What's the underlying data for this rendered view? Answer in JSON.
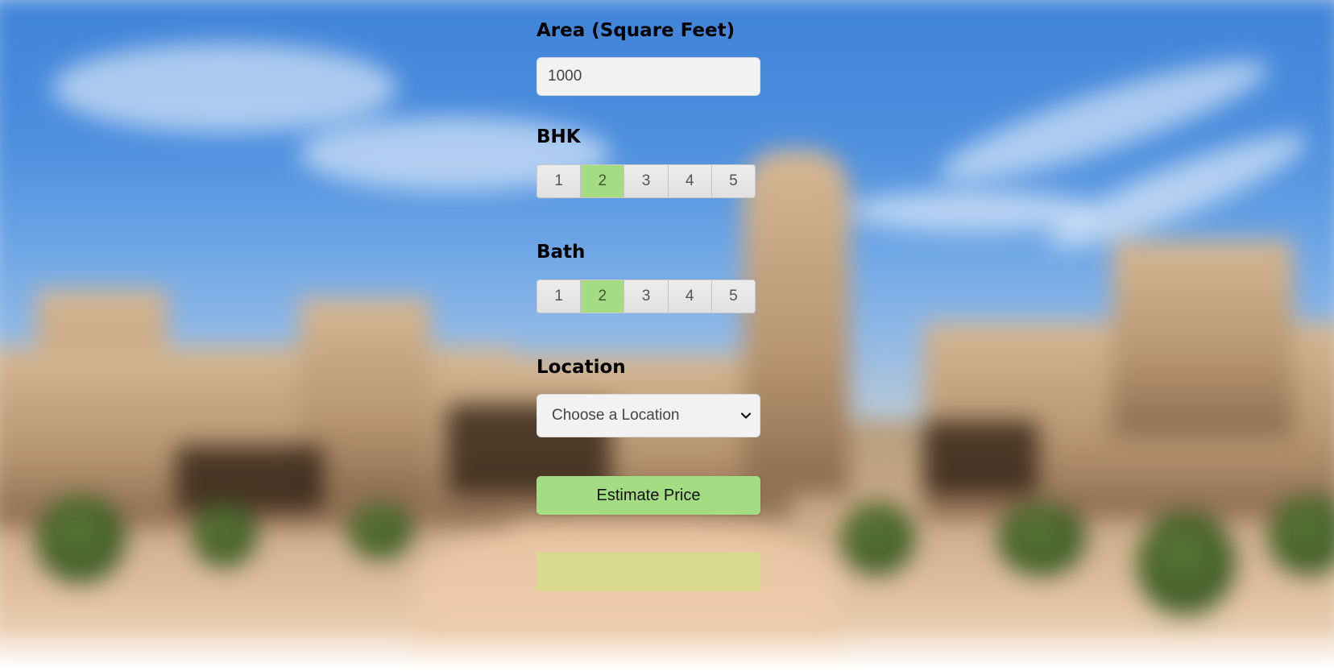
{
  "form": {
    "area": {
      "label": "Area (Square Feet)",
      "value": "1000"
    },
    "bhk": {
      "label": "BHK",
      "options": [
        "1",
        "2",
        "3",
        "4",
        "5"
      ],
      "selected": "2"
    },
    "bath": {
      "label": "Bath",
      "options": [
        "1",
        "2",
        "3",
        "4",
        "5"
      ],
      "selected": "2"
    },
    "location": {
      "label": "Location",
      "selected_text": "Choose a Location"
    },
    "estimate_button": {
      "label": "Estimate Price"
    },
    "result": {
      "text": ""
    }
  },
  "colors": {
    "selected_segment": "#a3dc82",
    "button": "#a3dc82",
    "result_box": "#d8db8c",
    "field_background": "#f2f2f2"
  },
  "icons": {
    "location_select": "chevron-down-icon"
  }
}
